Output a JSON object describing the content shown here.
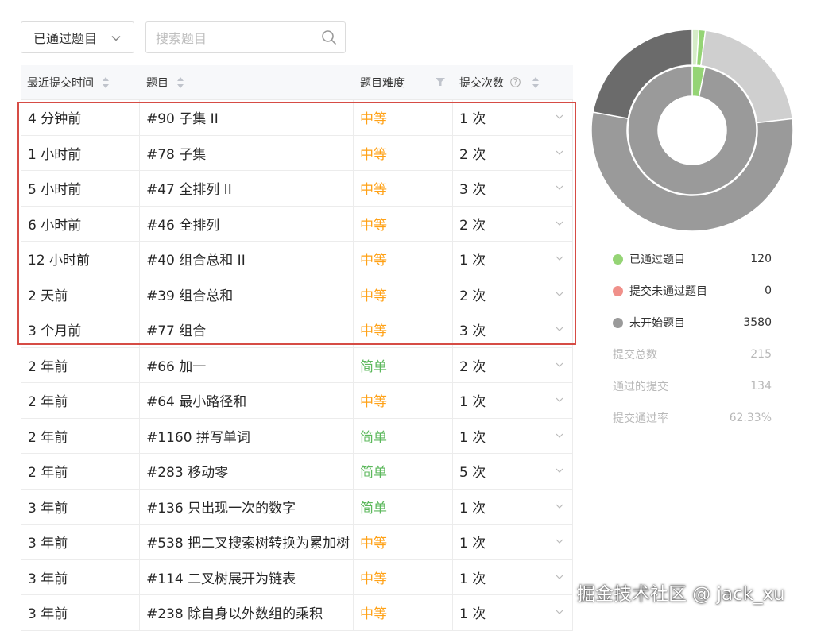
{
  "toolbar": {
    "status_filter": "已通过题目",
    "search_placeholder": "搜索题目"
  },
  "table": {
    "headers": {
      "time": "最近提交时间",
      "title": "题目",
      "difficulty": "题目难度",
      "submissions": "提交次数"
    },
    "rows": [
      {
        "time": "4 分钟前",
        "title": "#90 子集 II",
        "difficulty": "中等",
        "submissions": "1 次"
      },
      {
        "time": "1 小时前",
        "title": "#78 子集",
        "difficulty": "中等",
        "submissions": "2 次"
      },
      {
        "time": "5 小时前",
        "title": "#47 全排列 II",
        "difficulty": "中等",
        "submissions": "3 次"
      },
      {
        "time": "6 小时前",
        "title": "#46 全排列",
        "difficulty": "中等",
        "submissions": "2 次"
      },
      {
        "time": "12 小时前",
        "title": "#40 组合总和 II",
        "difficulty": "中等",
        "submissions": "1 次"
      },
      {
        "time": "2 天前",
        "title": "#39 组合总和",
        "difficulty": "中等",
        "submissions": "2 次"
      },
      {
        "time": "3 个月前",
        "title": "#77 组合",
        "difficulty": "中等",
        "submissions": "3 次"
      },
      {
        "time": "2 年前",
        "title": "#66 加一",
        "difficulty": "简单",
        "submissions": "2 次"
      },
      {
        "time": "2 年前",
        "title": "#64 最小路径和",
        "difficulty": "中等",
        "submissions": "1 次"
      },
      {
        "time": "2 年前",
        "title": "#1160 拼写单词",
        "difficulty": "简单",
        "submissions": "1 次"
      },
      {
        "time": "2 年前",
        "title": "#283 移动零",
        "difficulty": "简单",
        "submissions": "5 次"
      },
      {
        "time": "3 年前",
        "title": "#136 只出现一次的数字",
        "difficulty": "简单",
        "submissions": "1 次"
      },
      {
        "time": "3 年前",
        "title": "#538 把二叉搜索树转换为累加树",
        "difficulty": "中等",
        "submissions": "1 次"
      },
      {
        "time": "3 年前",
        "title": "#114 二叉树展开为链表",
        "difficulty": "中等",
        "submissions": "1 次"
      },
      {
        "time": "3 年前",
        "title": "#238 除自身以外数组的乘积",
        "difficulty": "中等",
        "submissions": "1 次"
      }
    ]
  },
  "stats": {
    "legend": [
      {
        "label": "已通过题目",
        "value": "120",
        "color": "#95d475"
      },
      {
        "label": "提交未通过题目",
        "value": "0",
        "color": "#f0908a"
      },
      {
        "label": "未开始题目",
        "value": "3580",
        "color": "#9a9a9a"
      }
    ],
    "totals": [
      {
        "label": "提交总数",
        "value": "215"
      },
      {
        "label": "通过的提交",
        "value": "134"
      },
      {
        "label": "提交通过率",
        "value": "62.33%"
      }
    ]
  },
  "donut": {
    "outer": [
      {
        "value": 1,
        "color": "#d5ecc7"
      },
      {
        "value": 1,
        "color": "#95d475"
      },
      {
        "value": 20,
        "color": "#cfcfcf"
      },
      {
        "value": 52,
        "color": "#9a9a9a"
      },
      {
        "value": 21,
        "color": "#6b6b6b"
      }
    ],
    "inner": [
      {
        "value": 3.2,
        "color": "#95d475"
      },
      {
        "value": 96.8,
        "color": "#9a9a9a"
      }
    ]
  },
  "colors": {
    "medium": "#ffa116",
    "easy": "#5cb85c",
    "highlight": "#d64c45"
  },
  "watermark": "掘金技术社区 @ jack_xu"
}
